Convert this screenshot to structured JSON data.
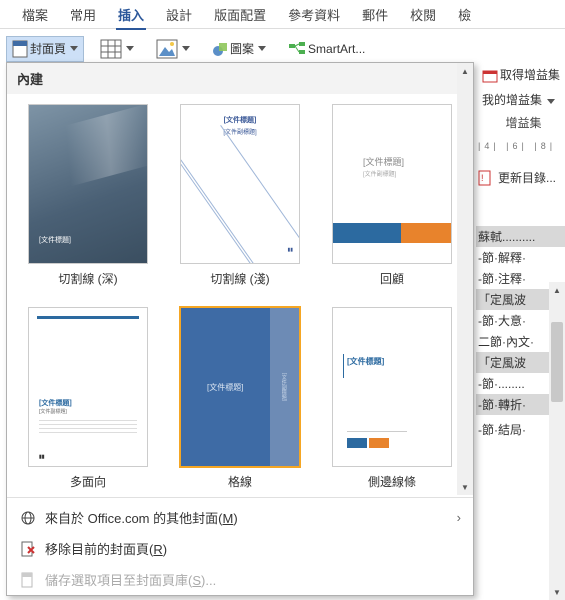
{
  "tabs": {
    "file": "檔案",
    "home": "常用",
    "insert": "插入",
    "design": "設計",
    "layout": "版面配置",
    "references": "參考資料",
    "mailings": "郵件",
    "review": "校閱",
    "view": "檢"
  },
  "toolbar": {
    "cover_page": "封面頁",
    "shapes": "圖案",
    "smartart": "SmartArt..."
  },
  "dropdown": {
    "header": "內建",
    "items": [
      {
        "label": "切割線 (深)",
        "thumb_title": "[文件標題]"
      },
      {
        "label": "切割線 (淺)",
        "thumb_title": "[文件標題]",
        "thumb_sub": "[文件副標題]"
      },
      {
        "label": "回顧",
        "thumb_title": "[文件標題]",
        "thumb_sub": "[文件副標題]"
      },
      {
        "label": "多面向",
        "thumb_title": "[文件標題]",
        "thumb_sub": "[文件副標題]"
      },
      {
        "label": "格線",
        "thumb_title": "[文件標題]",
        "thumb_sub": "[文件副標題]"
      },
      {
        "label": "側邊線條",
        "thumb_title": "[文件標題]"
      }
    ],
    "more_office": "來自於 Office.com 的其他封面",
    "more_office_key": "M",
    "remove": "移除目前的封面頁",
    "remove_key": "R",
    "save_sel": "儲存選取項目至封面頁庫",
    "save_sel_key": "S"
  },
  "right": {
    "get_addins": "取得增益集",
    "my_addins": "我的增益集",
    "group_label": "增益集",
    "ruler": "|4| |6| |8|",
    "update_toc": "更新目錄...",
    "lines": [
      "蘇軾..........",
      "-節·解釋·",
      "-節·注釋·",
      "「定風波",
      "-節·大意·",
      "二節·內文·",
      "「定風波",
      "-節·........",
      "-節·轉折·",
      "",
      "-節·結局·"
    ]
  }
}
